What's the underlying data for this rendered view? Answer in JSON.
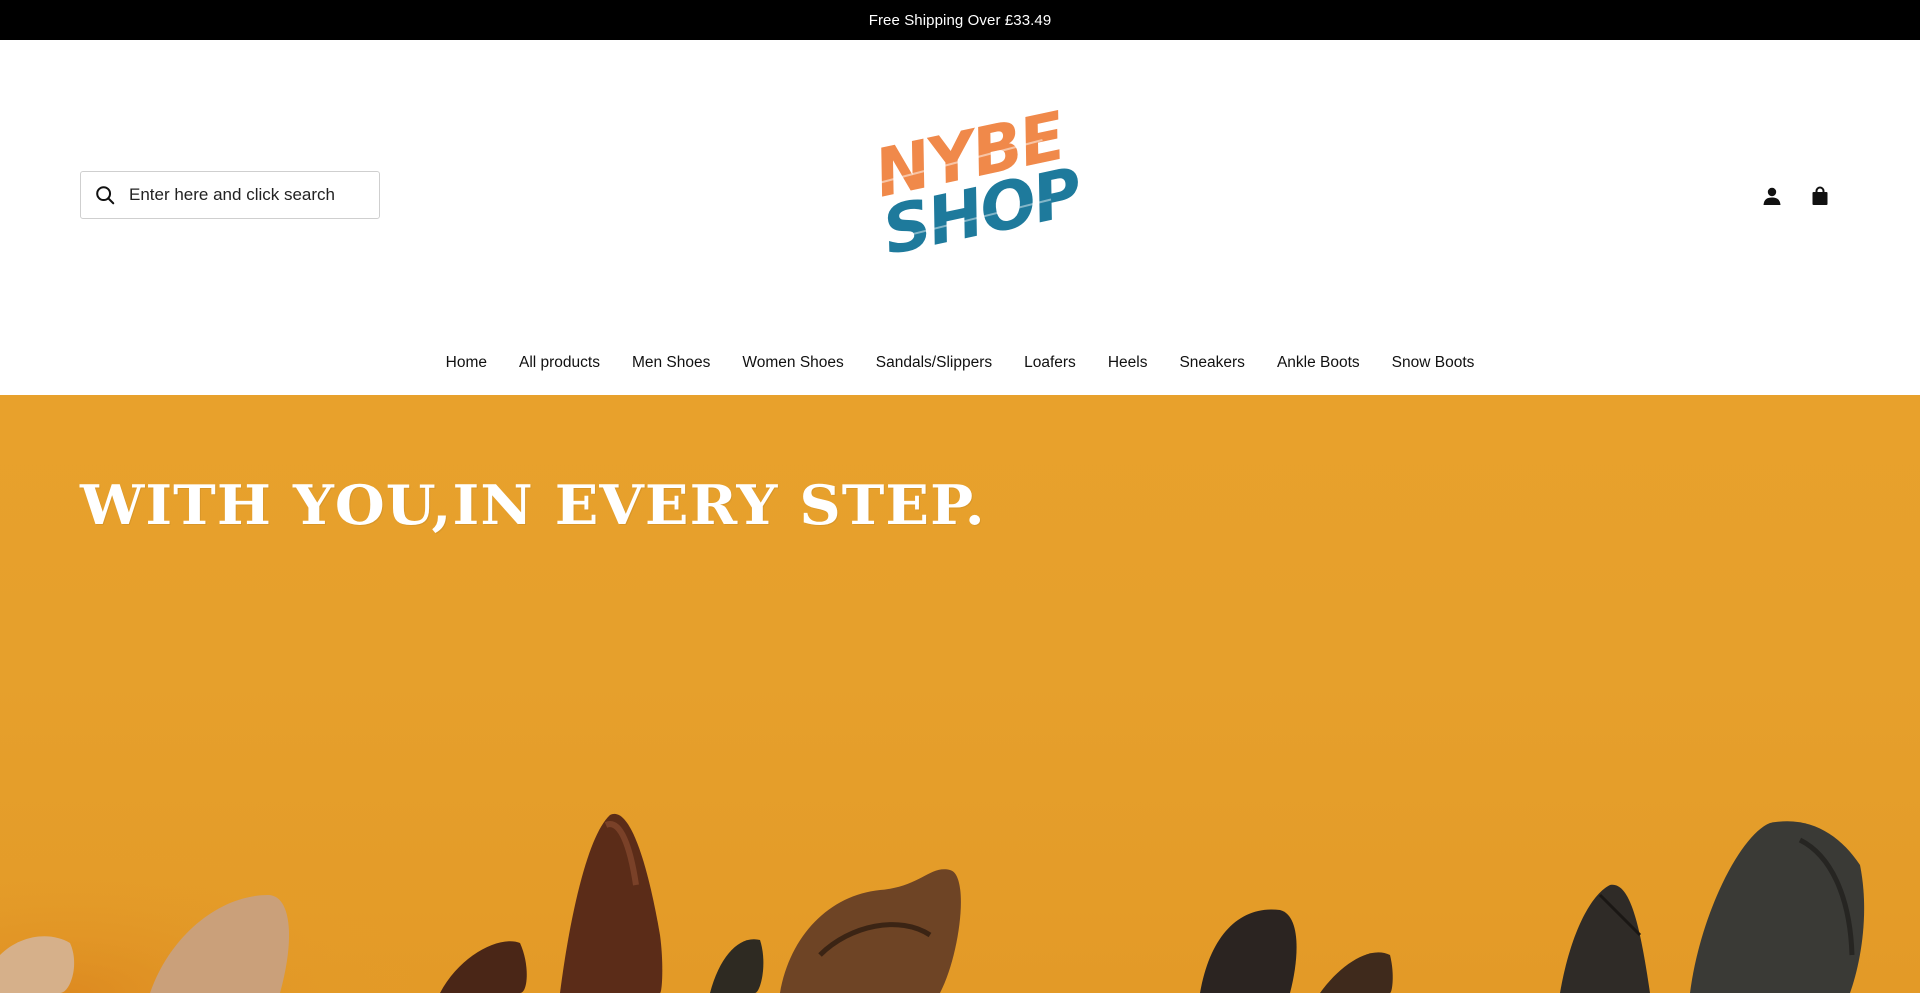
{
  "announcement": {
    "text": "Free Shipping Over £33.49"
  },
  "search": {
    "placeholder": "Enter here and click search"
  },
  "logo": {
    "line1": "NYBE",
    "line2": "SHOP"
  },
  "nav": {
    "items": [
      {
        "label": "Home"
      },
      {
        "label": "All products"
      },
      {
        "label": "Men Shoes"
      },
      {
        "label": "Women Shoes"
      },
      {
        "label": "Sandals/Slippers"
      },
      {
        "label": "Loafers"
      },
      {
        "label": "Heels"
      },
      {
        "label": "Sneakers"
      },
      {
        "label": "Ankle Boots"
      },
      {
        "label": "Snow Boots"
      }
    ]
  },
  "hero": {
    "title": "WITH YOU,IN EVERY STEP."
  },
  "icons": {
    "search": "search-icon",
    "account": "user-icon",
    "cart": "shopping-bag-icon"
  },
  "colors": {
    "announce_bg": "#000000",
    "hero_bg": "#e6a02c",
    "logo_orange": "#f0894a",
    "logo_blue": "#1e7a9c"
  }
}
